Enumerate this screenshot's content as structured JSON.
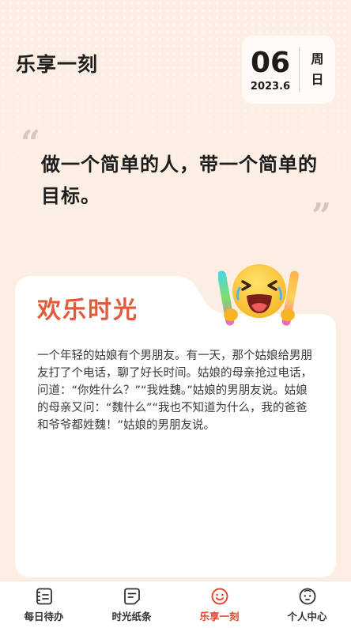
{
  "header": {
    "title": "乐享一刻"
  },
  "date": {
    "day": "06",
    "year_month": "2023.6",
    "week_1": "周",
    "week_2": "日"
  },
  "quote": {
    "open_mark": "“",
    "close_mark": "”",
    "text": "做一个简单的人，带一个简单的目标。"
  },
  "card": {
    "title": "欢乐时光",
    "text": "一个年轻的姑娘有个男朋友。有一天，那个姑娘给男朋友打了个电话，聊了好长时间。姑娘的母亲抢过电话，问道：“你姓什么？”“我姓魏。”姑娘的男朋友说。姑娘的母亲又问：“魏什么”“我也不知道为什么，我的爸爸和爷爷都姓魏！”姑娘的男朋友说。"
  },
  "tabs": [
    {
      "label": "每日待办",
      "icon": "todo-list-icon",
      "active": false
    },
    {
      "label": "时光纸条",
      "icon": "note-icon",
      "active": false
    },
    {
      "label": "乐享一刻",
      "icon": "smile-icon",
      "active": true
    },
    {
      "label": "个人中心",
      "icon": "profile-face-icon",
      "active": false
    }
  ],
  "colors": {
    "accent": "#e2452b",
    "card_title": "#e05a3c",
    "background": "#fdeee3"
  }
}
